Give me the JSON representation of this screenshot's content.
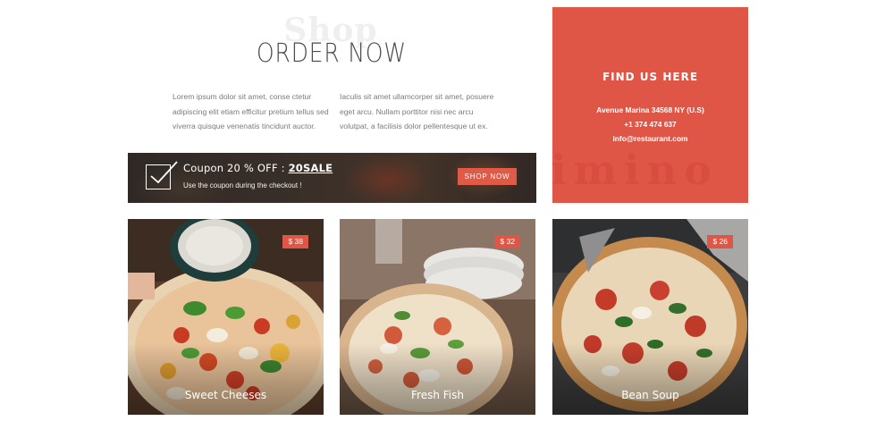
{
  "order": {
    "watermark": "Shop",
    "title": "ORDER NOW",
    "text_left": "Lorem ipsum dolor sit amet, conse ctetur adipiscing elit etiam efficitur pretium tellus sed viverra quisque venenatis tincidunt auctor.",
    "text_right": "Iaculis sit amet ullamcorper sit amet, posuere eget arcu. Nullam porttitor nisi nec arcu volutpat, a facilisis dolor pellentesque ut ex."
  },
  "coupon": {
    "title_prefix": "Coupon 20 % OFF : ",
    "code": "20SALE",
    "subtitle": "Use the coupon during the checkout !",
    "button": "SHOP NOW",
    "icon": "checkbox-check-icon"
  },
  "find_us": {
    "title": "FIND US HERE",
    "watermark": "imino",
    "address": "Avenue Marina 34568 NY (U.S)",
    "phone": "+1 374 474 637",
    "email": "info@restaurant.com"
  },
  "products": [
    {
      "name": "Sweet Cheeses",
      "price": "$ 38"
    },
    {
      "name": "Fresh Fish",
      "price": "$ 32"
    },
    {
      "name": "Bean Soup",
      "price": "$ 26"
    }
  ],
  "colors": {
    "accent": "#e05646",
    "button": "#e05a48",
    "heading": "#4a4a4a",
    "body_text": "#7b7b7b"
  }
}
